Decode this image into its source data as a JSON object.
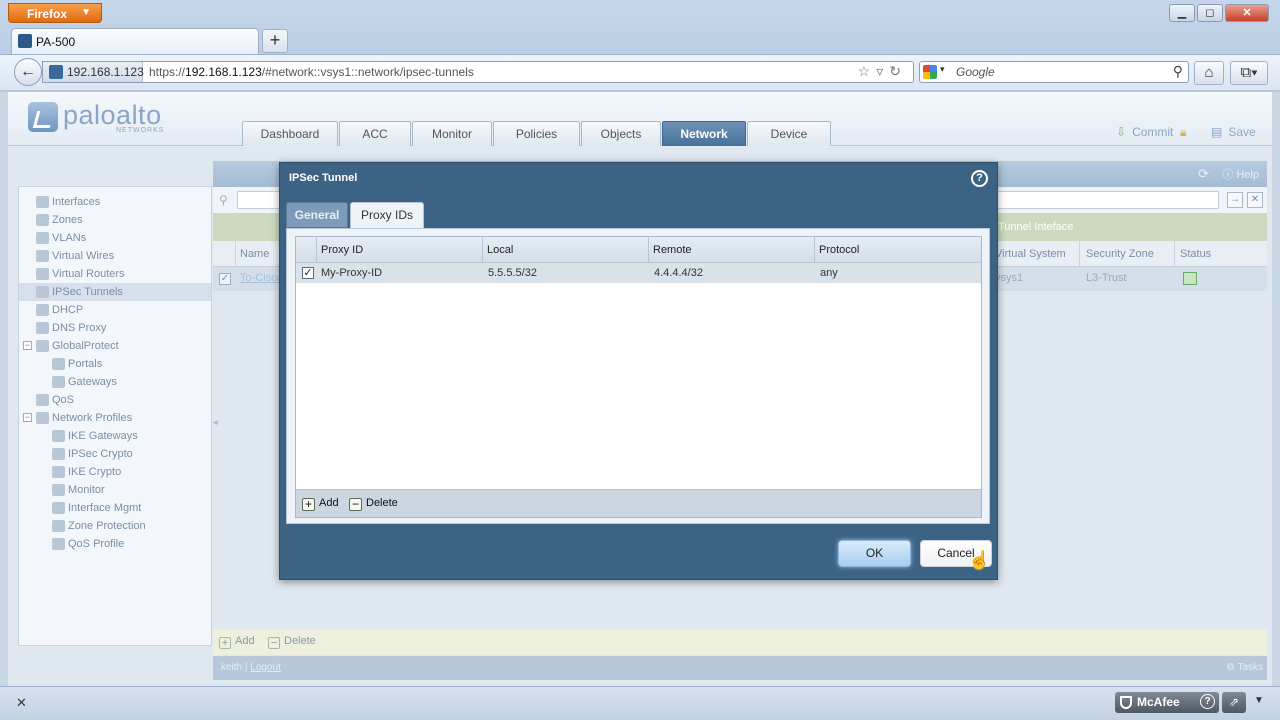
{
  "browser": {
    "menu_label": "Firefox",
    "tab_title": "PA-500",
    "site_identity": "192.168.1.123",
    "url_prefix": "https://",
    "url_host": "192.168.1.123",
    "url_path": "/#network::vsys1::network/ipsec-tunnels",
    "search_placeholder": "Google"
  },
  "app": {
    "logo_text": "paloalto",
    "logo_sub": "NETWORKS",
    "main_tabs": [
      {
        "label": "Dashboard"
      },
      {
        "label": "ACC"
      },
      {
        "label": "Monitor"
      },
      {
        "label": "Policies"
      },
      {
        "label": "Objects"
      },
      {
        "label": "Network",
        "active": true
      },
      {
        "label": "Device"
      }
    ],
    "commit_label": "Commit",
    "save_label": "Save",
    "help_label": "Help",
    "sidebar": [
      {
        "label": "Interfaces"
      },
      {
        "label": "Zones"
      },
      {
        "label": "VLANs"
      },
      {
        "label": "Virtual Wires"
      },
      {
        "label": "Virtual Routers"
      },
      {
        "label": "IPSec Tunnels",
        "selected": true
      },
      {
        "label": "DHCP"
      },
      {
        "label": "DNS Proxy"
      },
      {
        "label": "GlobalProtect",
        "toggle": "−"
      },
      {
        "label": "Portals",
        "child": true
      },
      {
        "label": "Gateways",
        "child": true
      },
      {
        "label": "QoS"
      },
      {
        "label": "Network Profiles",
        "toggle": "−"
      },
      {
        "label": "IKE Gateways",
        "child": true
      },
      {
        "label": "IPSec Crypto",
        "child": true
      },
      {
        "label": "IKE Crypto",
        "child": true
      },
      {
        "label": "Monitor",
        "child": true
      },
      {
        "label": "Interface Mgmt",
        "child": true
      },
      {
        "label": "Zone Protection",
        "child": true
      },
      {
        "label": "QoS Profile",
        "child": true
      }
    ],
    "grid": {
      "group_header": "Tunnel Inteface",
      "columns": {
        "name": "Name",
        "virtual_system": "Virtual System",
        "security_zone": "Security Zone",
        "status": "Status"
      },
      "row": {
        "name": "To-Cisco",
        "virtual_system": "vsys1",
        "security_zone": "L3-Trust"
      },
      "add_label": "Add",
      "delete_label": "Delete"
    },
    "status_bar": {
      "user": "keith",
      "separator": "|",
      "logout": "Logout",
      "tasks": "Tasks"
    }
  },
  "dialog": {
    "title": "IPSec Tunnel",
    "tabs": [
      {
        "label": "General"
      },
      {
        "label": "Proxy IDs",
        "active": true
      }
    ],
    "columns": {
      "proxy_id": "Proxy ID",
      "local": "Local",
      "remote": "Remote",
      "protocol": "Protocol"
    },
    "rows": [
      {
        "checked": true,
        "proxy_id": "My-Proxy-ID",
        "local": "5.5.5.5/32",
        "remote": "4.4.4.4/32",
        "protocol": "any"
      }
    ],
    "add_label": "Add",
    "delete_label": "Delete",
    "ok_label": "OK",
    "cancel_label": "Cancel"
  },
  "addon_bar": {
    "mcafee_label": "McAfee"
  }
}
